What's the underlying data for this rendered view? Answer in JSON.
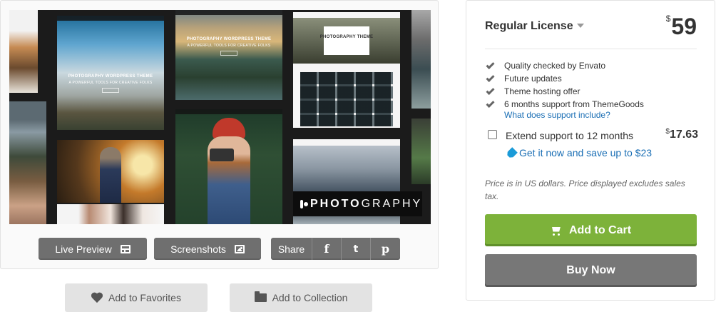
{
  "preview": {
    "shots": [
      {
        "caption": "PHOTOGRAPHY WORDPRESS THEME",
        "subcaption": "A POWERFUL TOOLS FOR CREATIVE FOLKS"
      },
      {
        "caption": "PHOTOGRAPHY WORDPRESS THEME",
        "subcaption": "A POWERFUL TOOLS FOR CREATIVE FOLKS"
      },
      {
        "caption": "PHOTOGRAPHY THEME",
        "subcaption": ""
      }
    ],
    "badge": {
      "bold": "PHOTO",
      "light": "GRAPHY"
    },
    "live_preview_label": "Live Preview",
    "screenshots_label": "Screenshots",
    "share_label": "Share",
    "social": {
      "facebook": "f",
      "twitter": "t",
      "pinterest": "p"
    },
    "favorites_label": "Add to Favorites",
    "collection_label": "Add to Collection"
  },
  "purchase": {
    "license_name": "Regular License",
    "currency_symbol": "$",
    "price": "59",
    "features": [
      "Quality checked by Envato",
      "Future updates",
      "Theme hosting offer",
      "6 months support from ThemeGoods"
    ],
    "support_link": "What does support include?",
    "extend_label": "Extend support to 12 months",
    "extend_price": "17.63",
    "save_link": "Get it now and save up to $23",
    "price_note": "Price is in US dollars. Price displayed excludes sales tax.",
    "add_to_cart": "Add to Cart",
    "buy_now": "Buy Now"
  },
  "colors": {
    "cart_green": "#7db23a",
    "buy_gray": "#777777",
    "link_blue": "#1b6fb5",
    "button_gray": "#6f6f6f"
  }
}
